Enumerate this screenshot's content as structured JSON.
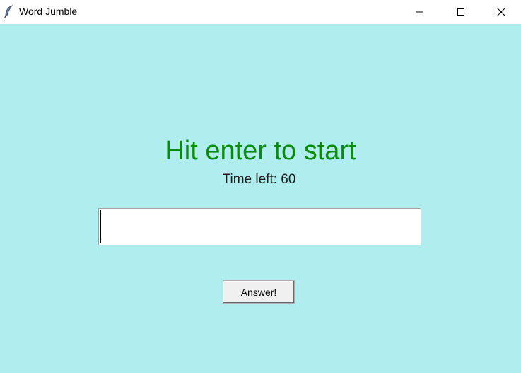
{
  "window": {
    "title": "Word Jumble",
    "icon": "feather-icon",
    "controls": {
      "minimize_icon": "minimize-icon",
      "maximize_icon": "maximize-icon",
      "close_icon": "close-icon"
    }
  },
  "game": {
    "headline": "Hit enter to start",
    "timer_label": "Time left: 60",
    "answer_input_value": "",
    "answer_button_label": "Answer!"
  },
  "colors": {
    "background": "#afedee",
    "headline": "#0b8a0b",
    "titlebar": "#ffffff"
  }
}
